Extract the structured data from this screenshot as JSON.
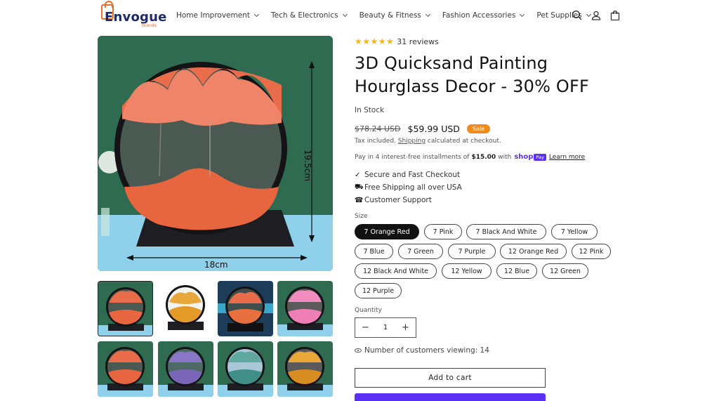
{
  "brand": {
    "name": "Envogue",
    "sub": "brands"
  },
  "nav": [
    {
      "label": "Home Improvement"
    },
    {
      "label": "Tech & Electronics"
    },
    {
      "label": "Beauty & Fitness"
    },
    {
      "label": "Fashion Accessories"
    },
    {
      "label": "Pet Supplies"
    }
  ],
  "header_icons": [
    "search-icon",
    "account-icon",
    "cart-icon"
  ],
  "gallery": {
    "main_image": {
      "height_label": "19.5cm",
      "width_label": "18cm"
    }
  },
  "product": {
    "stars": "★★★★★",
    "reviews": "31 reviews",
    "title": "3D Quicksand Painting Hourglass Decor - 30% OFF",
    "stock": "In Stock",
    "old_price": "$78.24 USD",
    "new_price": "$59.99 USD",
    "sale_badge": "Sale",
    "tax_prefix": "Tax included.",
    "tax_link": "Shipping",
    "tax_suffix": "calculated at checkout.",
    "installments_prefix": "Pay in 4 interest-free installments of",
    "installments_amount": "$15.00",
    "installments_with": "with",
    "shop_text": "shop",
    "pay_text": "Pay",
    "learn_more": "Learn more",
    "features": [
      {
        "icon": "check-icon",
        "label": "Secure and Fast Checkout"
      },
      {
        "icon": "truck-icon",
        "label": "Free Shipping all over USA"
      },
      {
        "icon": "phone-icon",
        "label": "Customer Support"
      }
    ],
    "size_label": "Size",
    "variants": [
      "7 Orange Red",
      "7 Pink",
      "7 Black And White",
      "7 Yellow",
      "7 Blue",
      "7 Green",
      "7 Purple",
      "12 Orange Red",
      "12 Pink",
      "12 Black And White",
      "12 Yellow",
      "12 Blue",
      "12 Green",
      "12 Purple"
    ],
    "selected_variant": "7 Orange Red",
    "quantity_label": "Quantity",
    "quantity": "1",
    "qty_minus": "−",
    "qty_plus": "+",
    "viewing": "Number of customers viewing: 14",
    "add_to_cart": "Add to cart"
  },
  "colors": {
    "accent": "#5a31f4",
    "sale": "#f28b1d",
    "stars": "#f5b619",
    "brand": "#1f2a6b"
  }
}
